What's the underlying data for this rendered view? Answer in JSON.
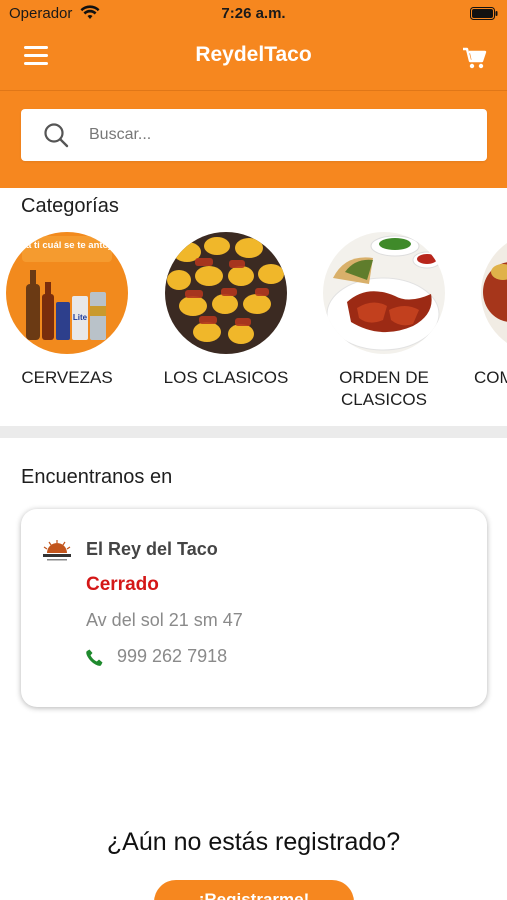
{
  "status_bar": {
    "carrier": "Operador",
    "time": "7:26 a.m."
  },
  "header": {
    "title": "ReydelTaco"
  },
  "search": {
    "placeholder": "Buscar..."
  },
  "categories": {
    "title": "Categorías",
    "items": [
      {
        "label": "CERVEZAS",
        "image_text": "¿Y a ti cuál se te antojo?"
      },
      {
        "label": "LOS CLASICOS"
      },
      {
        "label": "ORDEN DE\nCLASICOS"
      },
      {
        "label": "COM"
      }
    ]
  },
  "locations": {
    "title": "Encuentranos en",
    "card": {
      "name": "El Rey del Taco",
      "status": "Cerrado",
      "address": "Av del sol 21 sm 47",
      "phone": "999 262 7918"
    }
  },
  "register": {
    "question": "¿Aún no estás registrado?",
    "button": "¡Registrarme!"
  },
  "colors": {
    "brand_orange": "#f6871f",
    "closed_red": "#d41717",
    "phone_green": "#1f8a2e"
  }
}
